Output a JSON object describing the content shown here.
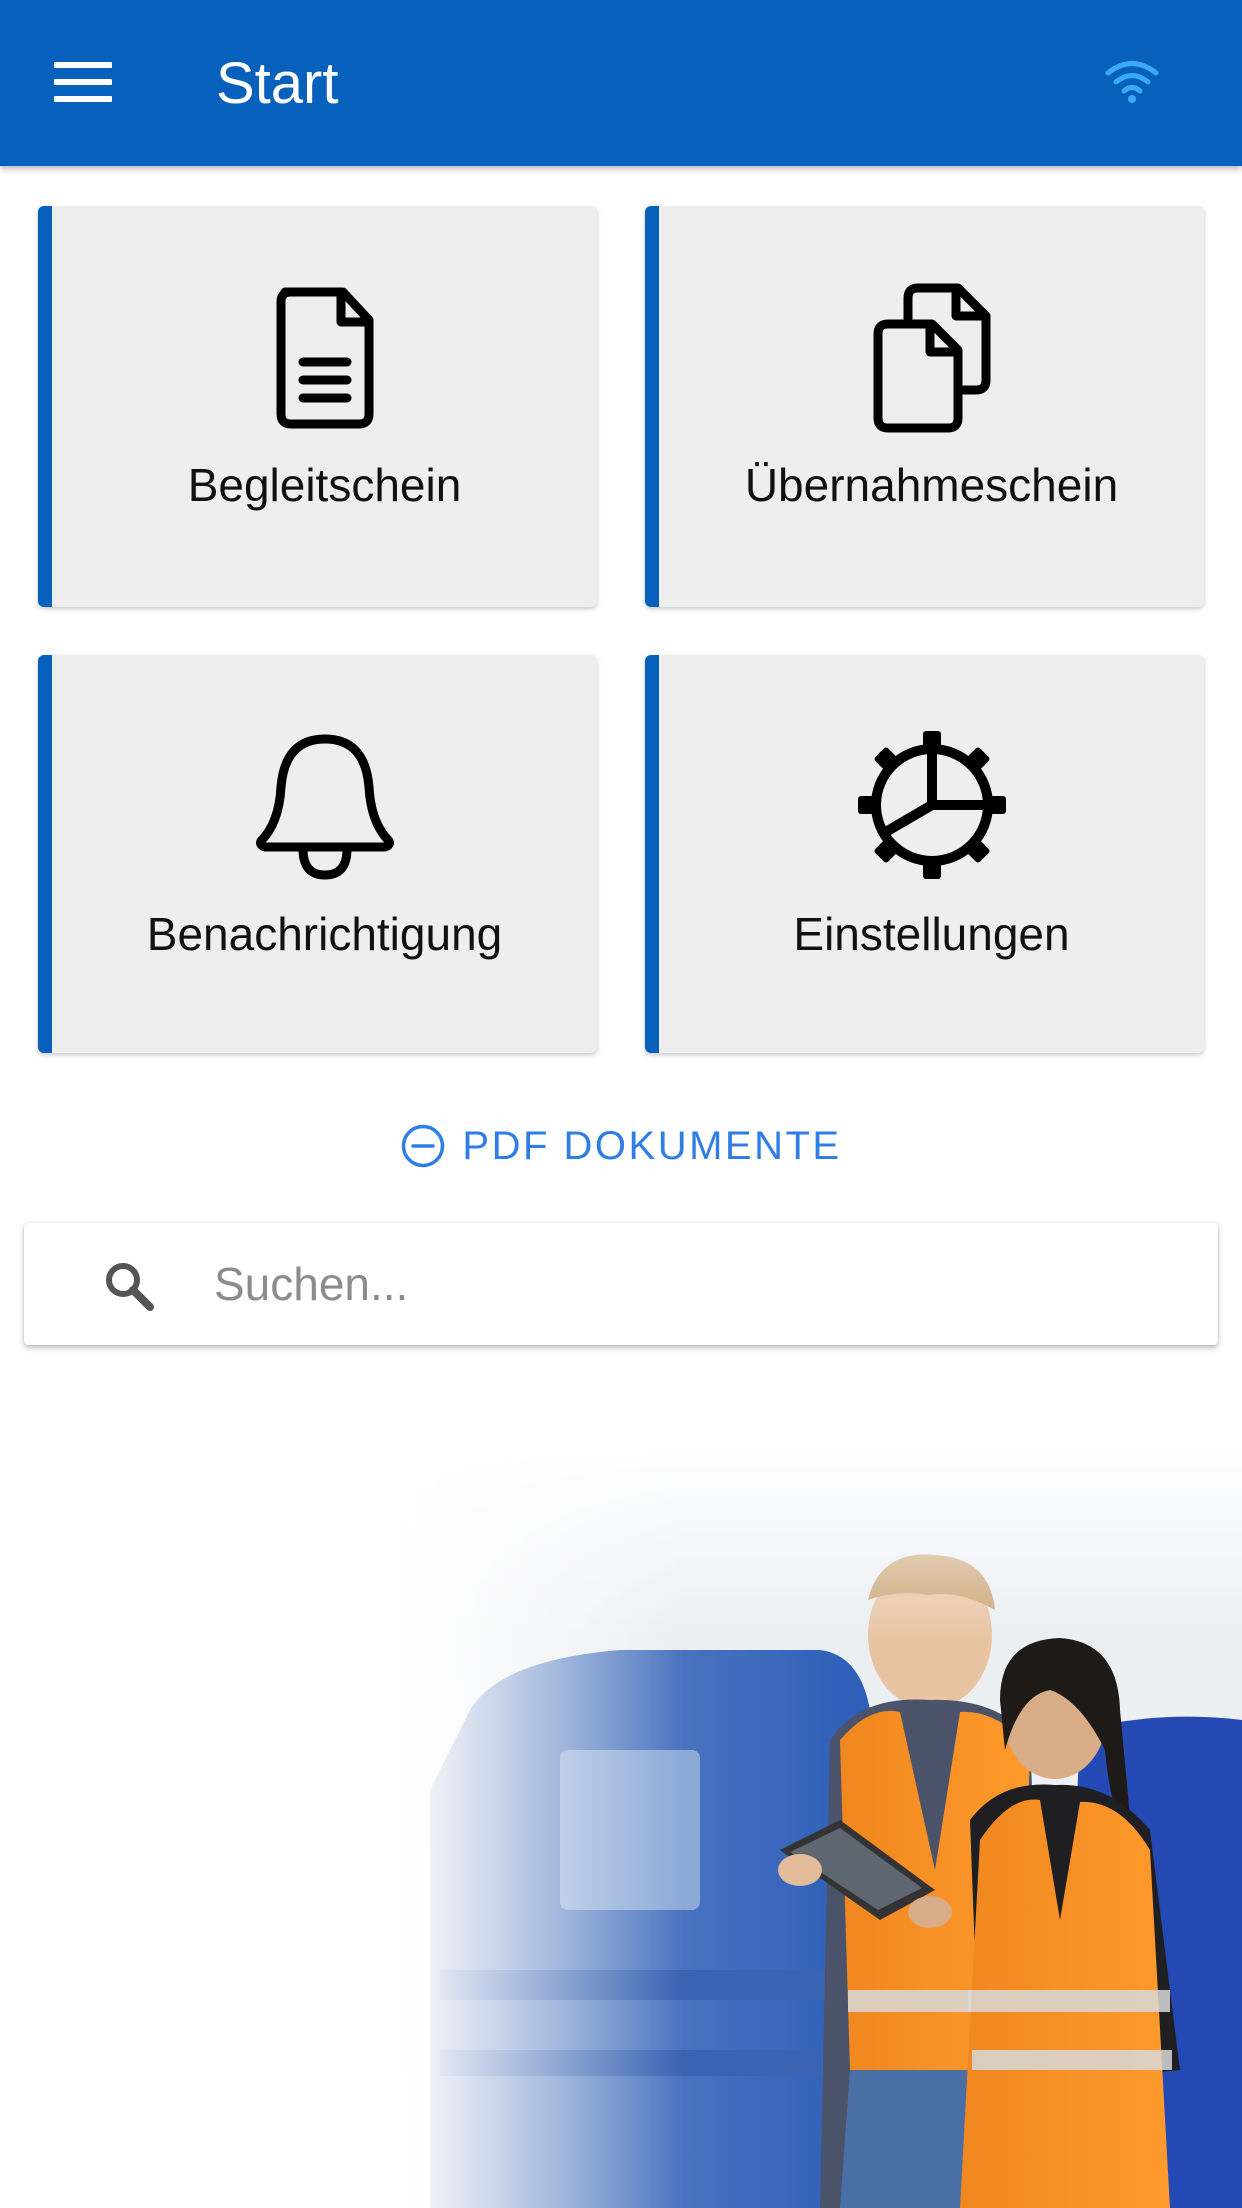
{
  "app_bar": {
    "title": "Start",
    "menu_icon": "menu-icon",
    "status_icon": "wifi-icon",
    "background_color": "#0760bb"
  },
  "tiles": [
    {
      "label": "Begleitschein",
      "icon": "document-icon"
    },
    {
      "label": "Übernahmeschein",
      "icon": "documents-copy-icon"
    },
    {
      "label": "Benachrichtigung",
      "icon": "bell-icon"
    },
    {
      "label": "Einstellungen",
      "icon": "gear-icon"
    }
  ],
  "pdf_toggle": {
    "label": "PDF DOKUMENTE",
    "icon": "minus-circle-icon",
    "color": "#2f7de6"
  },
  "search": {
    "placeholder": "Suchen...",
    "value": "",
    "icon": "search-icon"
  },
  "theme": {
    "accent": "#0760bb",
    "wifi_color": "#3aaaf5",
    "tile_background": "#eeeeee"
  }
}
